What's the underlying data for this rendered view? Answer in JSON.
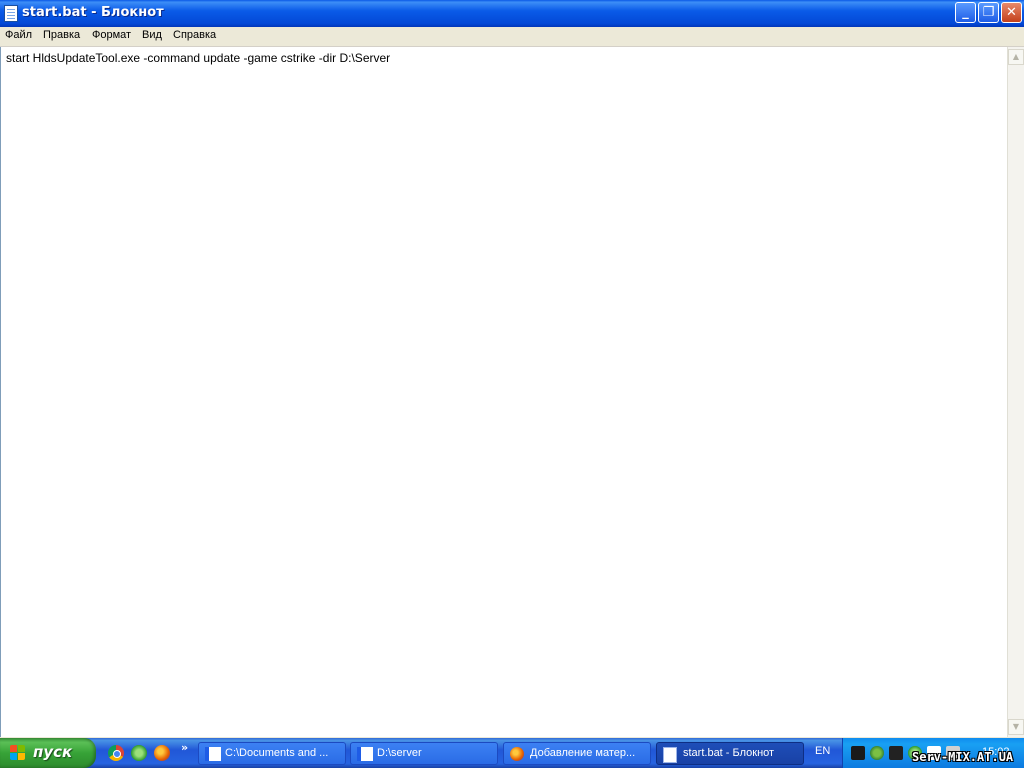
{
  "window": {
    "title": "start.bat - Блокнот"
  },
  "menu": {
    "items": [
      "Файл",
      "Правка",
      "Формат",
      "Вид",
      "Справка"
    ]
  },
  "editor": {
    "text": "start HldsUpdateTool.exe -command update -game cstrike -dir D:\\Server"
  },
  "taskbar": {
    "start_label": "пуск",
    "quicklaunch": [
      "chrome-icon",
      "recycle-icon",
      "firefox-icon"
    ],
    "tasks": [
      {
        "label": "C:\\Documents and ...",
        "icon": "folder-icon",
        "active": false
      },
      {
        "label": "D:\\server",
        "icon": "folder-icon",
        "active": false
      },
      {
        "label": "Добавление матер...",
        "icon": "firefox-icon",
        "active": false
      },
      {
        "label": "start.bat - Блокнот",
        "icon": "notepad-icon",
        "active": true
      }
    ],
    "language": "EN",
    "clock": "15:02",
    "watermark": "Serv-MIX.AT.UA"
  },
  "colors": {
    "titlebar": "#0A5BE8",
    "taskbar": "#2157D7",
    "start_button": "#37A337",
    "tray": "#0C7AE0"
  }
}
